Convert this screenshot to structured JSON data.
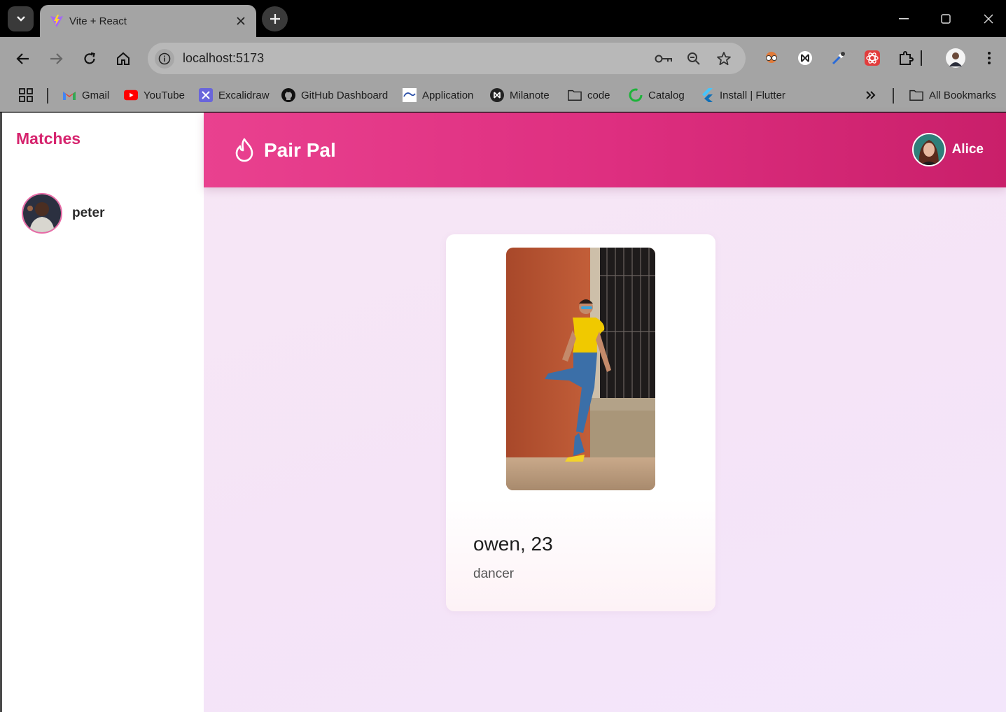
{
  "browser": {
    "tab_title": "Vite + React",
    "url": "localhost:5173",
    "bookmarks": [
      {
        "label": "Gmail",
        "icon": "gmail-icon"
      },
      {
        "label": "YouTube",
        "icon": "youtube-icon"
      },
      {
        "label": "Excalidraw",
        "icon": "excalidraw-icon"
      },
      {
        "label": "GitHub Dashboard",
        "icon": "github-icon"
      },
      {
        "label": "Application",
        "icon": "application-icon"
      },
      {
        "label": "Milanote",
        "icon": "milanote-icon"
      },
      {
        "label": "code",
        "icon": "folder-icon"
      },
      {
        "label": "Catalog",
        "icon": "catalog-icon"
      },
      {
        "label": "Install | Flutter",
        "icon": "flutter-icon"
      }
    ],
    "all_bookmarks_label": "All Bookmarks"
  },
  "sidebar": {
    "title": "Matches",
    "matches": [
      {
        "name": "peter"
      }
    ]
  },
  "header": {
    "brand": "Pair Pal",
    "user_name": "Alice"
  },
  "profile": {
    "name_age": "owen, 23",
    "occupation": "dancer"
  },
  "colors": {
    "accent": "#d6246e",
    "header_start": "#e9418f",
    "header_end": "#c91f6a",
    "background": "#f6e7f5"
  }
}
